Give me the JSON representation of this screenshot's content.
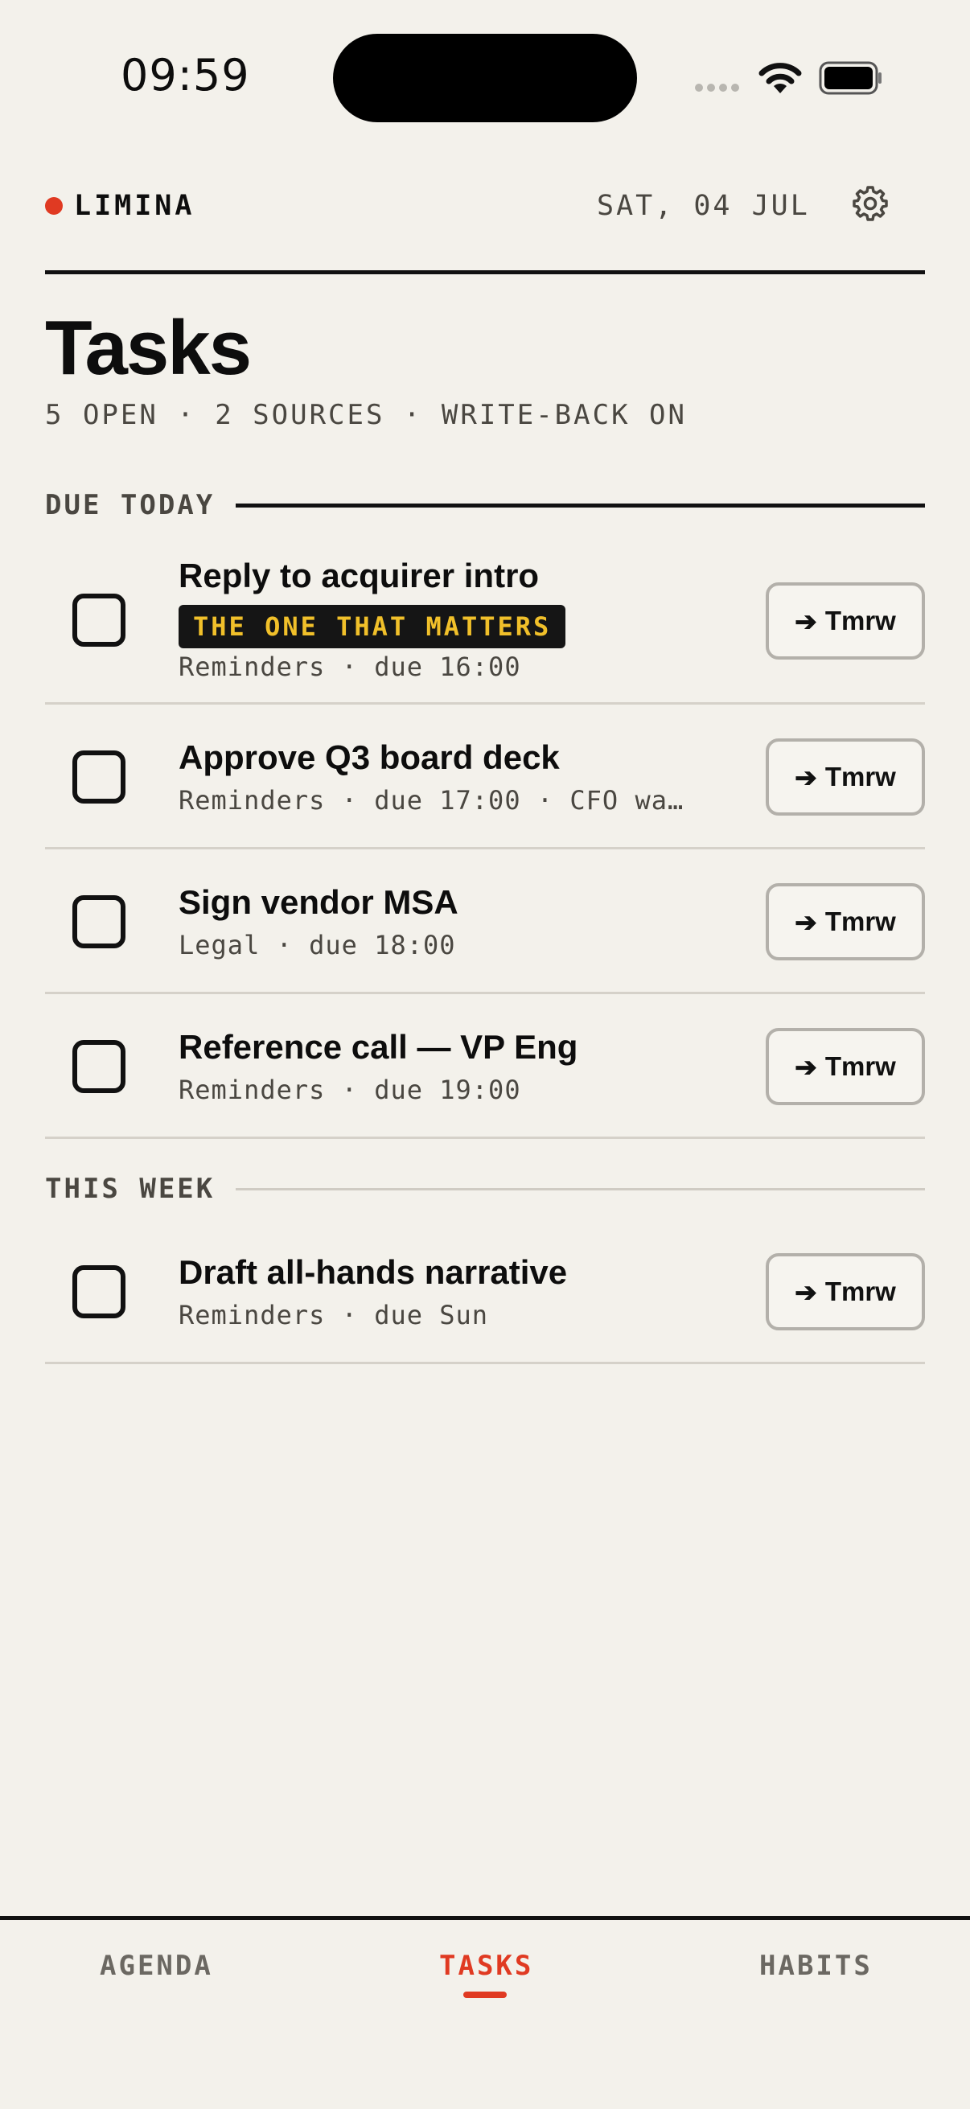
{
  "status": {
    "time": "09:59"
  },
  "header": {
    "brand": "LIMINA",
    "date": "SAT, 04 JUL",
    "title": "Tasks",
    "subtitle": "5 OPEN · 2 SOURCES · WRITE-BACK ON"
  },
  "sections": {
    "today": {
      "label": "DUE TODAY"
    },
    "week": {
      "label": "THIS WEEK"
    }
  },
  "tasks": [
    {
      "title": "Reply to acquirer intro",
      "tag": "THE ONE THAT MATTERS",
      "meta": "Reminders · due 16:00",
      "action": "Tmrw"
    },
    {
      "title": "Approve Q3 board deck",
      "meta": "Reminders · due 17:00 · CFO wa…",
      "action": "Tmrw"
    },
    {
      "title": "Sign vendor MSA",
      "meta": "Legal · due 18:00",
      "action": "Tmrw"
    },
    {
      "title": "Reference call — VP Eng",
      "meta": "Reminders · due 19:00",
      "action": "Tmrw"
    },
    {
      "title": "Draft all-hands narrative",
      "meta": "Reminders · due Sun",
      "action": "Tmrw"
    }
  ],
  "tabs": [
    {
      "label": "AGENDA"
    },
    {
      "label": "TASKS"
    },
    {
      "label": "HABITS"
    }
  ],
  "colors": {
    "accent": "#e03a22",
    "background": "#f3f1eb",
    "tag_text": "#f1c02a"
  }
}
